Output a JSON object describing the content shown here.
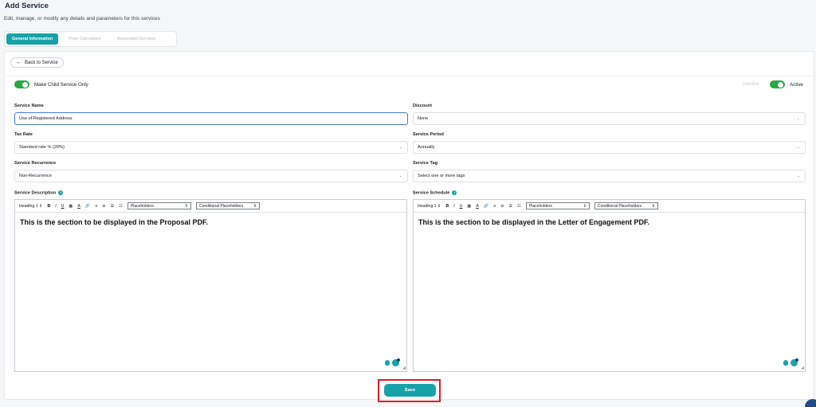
{
  "header": {
    "title": "Add Service",
    "subtitle": "Edit, manage, or modify any details and parameters for this services"
  },
  "tabs": [
    {
      "label": "General Information",
      "active": true
    },
    {
      "label": "Price Calculation",
      "active": false
    },
    {
      "label": "Associated Services",
      "active": false
    }
  ],
  "back_button": "Back to Service",
  "toggles": {
    "child_label": "Make Child Service Only",
    "inactive_label": "Inactive",
    "active_label": "Active"
  },
  "form": {
    "service_name": {
      "label": "Service Name",
      "value": "Use of Registered Address"
    },
    "discount": {
      "label": "Discount",
      "value": "None"
    },
    "tax_rate": {
      "label": "Tax Rate",
      "value": "Standard rate % (20%)"
    },
    "service_period": {
      "label": "Service Period",
      "value": "Annually"
    },
    "service_recurrence": {
      "label": "Service Recurrence",
      "value": "Non-Recurrence"
    },
    "service_tag": {
      "label": "Service Tag",
      "value": "Select one or more tags"
    }
  },
  "editors": {
    "description": {
      "label": "Service Description",
      "content": "This is the section to be displayed in the Proposal PDF."
    },
    "schedule": {
      "label": "Service Schedule",
      "content": "This is the section to be displayed in the Letter of Engagement PDF."
    },
    "toolbar": {
      "heading": "Heading 1",
      "placeholders": "Placeholders",
      "conditional": "Conditional Placeholders"
    }
  },
  "save_label": "Save",
  "colors": {
    "accent": "#17a2a8",
    "toggle_on": "#28a745",
    "highlight": "#e11d2a"
  }
}
